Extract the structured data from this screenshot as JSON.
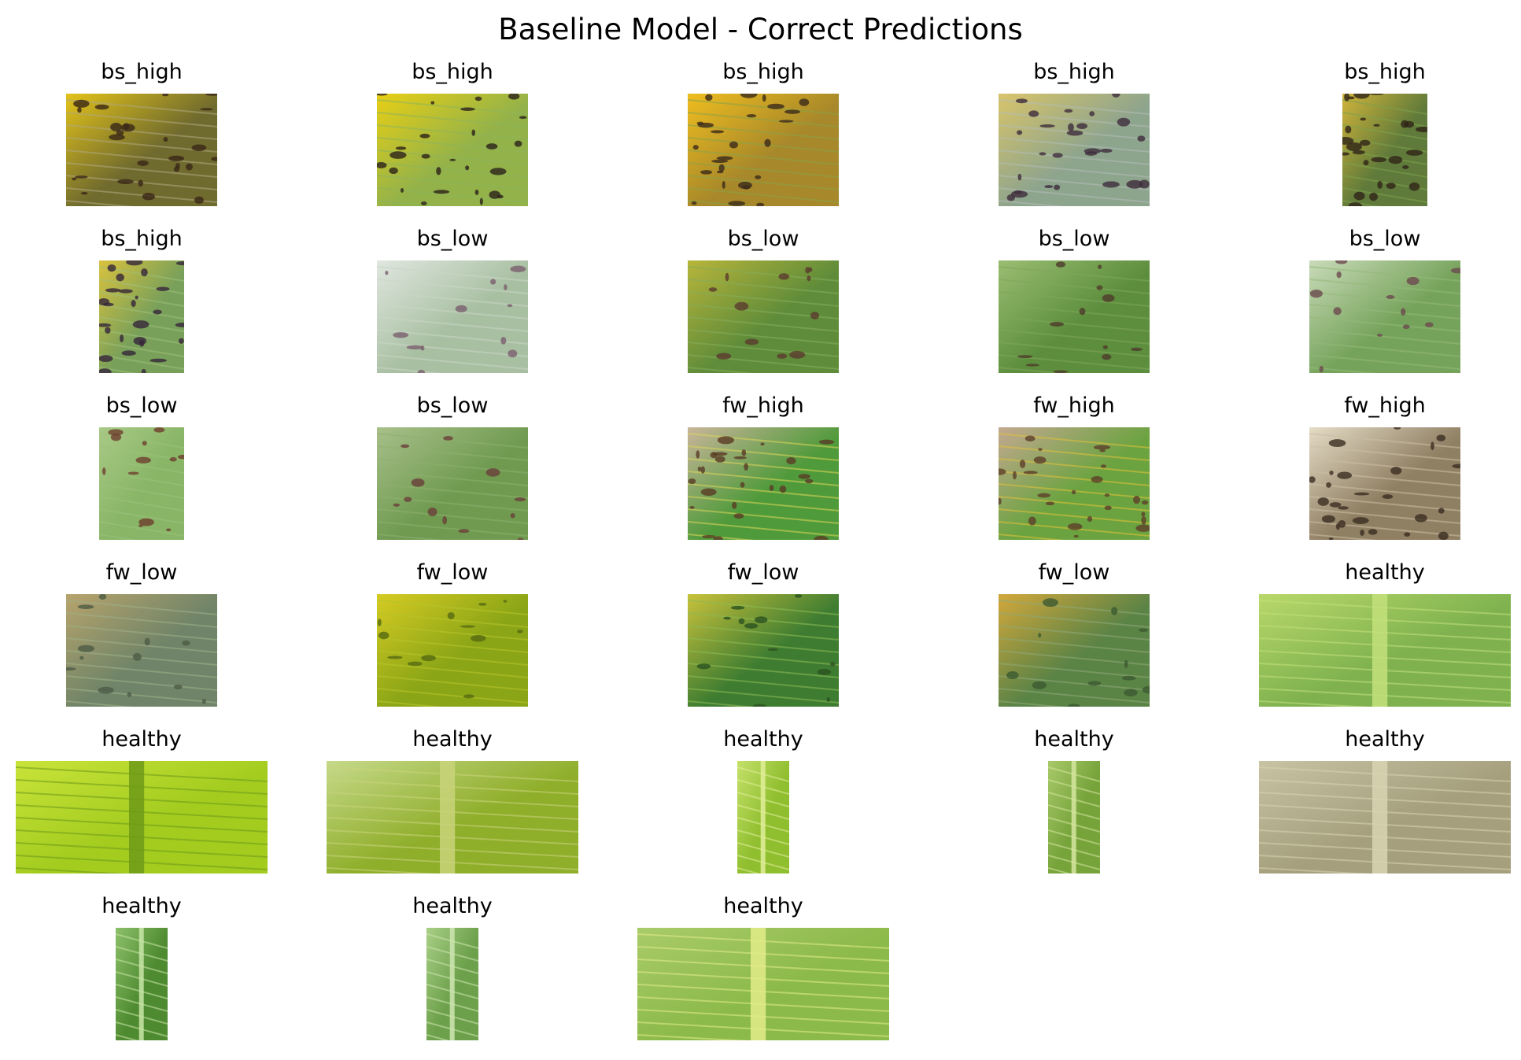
{
  "title": "Baseline Model - Correct Predictions",
  "columns": 5,
  "panels": [
    {
      "label": "bs_high",
      "aspect": "landscape",
      "palette": {
        "base": "#6f6a2e",
        "accent": "#e3c31a",
        "spot": "#3a2716",
        "vein": "#b0a880"
      }
    },
    {
      "label": "bs_high",
      "aspect": "landscape",
      "palette": {
        "base": "#93b24a",
        "accent": "#e8cf14",
        "spot": "#2d2219",
        "vein": "#8fb55c"
      }
    },
    {
      "label": "bs_high",
      "aspect": "landscape",
      "palette": {
        "base": "#a7882a",
        "accent": "#efbd1f",
        "spot": "#3b2a1a",
        "vein": "#8aa34a"
      }
    },
    {
      "label": "bs_high",
      "aspect": "landscape",
      "palette": {
        "base": "#8da48d",
        "accent": "#d8c46a",
        "spot": "#3e2d3c",
        "vein": "#b3bdb6"
      }
    },
    {
      "label": "bs_high",
      "aspect": "narrow",
      "palette": {
        "base": "#5f7a3a",
        "accent": "#d1b43b",
        "spot": "#2f2418",
        "vein": "#7ea24d"
      }
    },
    {
      "label": "bs_high",
      "aspect": "narrow",
      "palette": {
        "base": "#79a05a",
        "accent": "#d9c23e",
        "spot": "#36263a",
        "vein": "#9fc07a"
      }
    },
    {
      "label": "bs_low",
      "aspect": "landscape",
      "palette": {
        "base": "#a8bfa2",
        "accent": "#e0e7df",
        "spot": "#7a5f6e",
        "vein": "#cbd6c7"
      }
    },
    {
      "label": "bs_low",
      "aspect": "landscape",
      "palette": {
        "base": "#5f8c3a",
        "accent": "#b7b53a",
        "spot": "#5b3b2e",
        "vein": "#86ad5c"
      }
    },
    {
      "label": "bs_low",
      "aspect": "landscape",
      "palette": {
        "base": "#5c8e3d",
        "accent": "#9bbd72",
        "spot": "#4f3b2c",
        "vein": "#7fa85a"
      }
    },
    {
      "label": "bs_low",
      "aspect": "landscape",
      "palette": {
        "base": "#76a35b",
        "accent": "#c9dbb9",
        "spot": "#6d4a4f",
        "vein": "#94b97a"
      }
    },
    {
      "label": "bs_low",
      "aspect": "narrow",
      "palette": {
        "base": "#88b566",
        "accent": "#a9c986",
        "spot": "#6e3e2e",
        "vein": "#9cc27c"
      }
    },
    {
      "label": "bs_low",
      "aspect": "landscape",
      "palette": {
        "base": "#6f9a50",
        "accent": "#a8c08a",
        "spot": "#6a3f3a",
        "vein": "#8fb06f"
      }
    },
    {
      "label": "fw_high",
      "aspect": "landscape",
      "palette": {
        "base": "#4f9a3a",
        "accent": "#c9b59a",
        "spot": "#5a3b26",
        "vein": "#dcd65a"
      }
    },
    {
      "label": "fw_high",
      "aspect": "landscape",
      "palette": {
        "base": "#6aa33f",
        "accent": "#c3a890",
        "spot": "#5e3f2b",
        "vein": "#e2c23a"
      }
    },
    {
      "label": "fw_high",
      "aspect": "landscape",
      "palette": {
        "base": "#8f7f63",
        "accent": "#e5dcc6",
        "spot": "#3b2e22",
        "vein": "#cbbfa3"
      }
    },
    {
      "label": "fw_low",
      "aspect": "landscape",
      "palette": {
        "base": "#6f8468",
        "accent": "#b8a46c",
        "spot": "#4e5b46",
        "vein": "#9fb08a"
      }
    },
    {
      "label": "fw_low",
      "aspect": "landscape",
      "palette": {
        "base": "#8aa516",
        "accent": "#d6cb23",
        "spot": "#566a12",
        "vein": "#b6c52b"
      }
    },
    {
      "label": "fw_low",
      "aspect": "landscape",
      "palette": {
        "base": "#3d7c31",
        "accent": "#c9c23b",
        "spot": "#2c5220",
        "vein": "#8dbb54"
      }
    },
    {
      "label": "fw_low",
      "aspect": "landscape",
      "palette": {
        "base": "#5a8346",
        "accent": "#d3a83b",
        "spot": "#3c5a31",
        "vein": "#8fa978"
      }
    },
    {
      "label": "healthy",
      "aspect": "wide",
      "palette": {
        "base": "#7fb24f",
        "accent": "#b9d86a",
        "spot": "#6ca142",
        "vein": "#c3e07b"
      }
    },
    {
      "label": "healthy",
      "aspect": "wide",
      "palette": {
        "base": "#a3cc1f",
        "accent": "#c9e33a",
        "spot": "#8ab21a",
        "vein": "#6d9a18"
      }
    },
    {
      "label": "healthy",
      "aspect": "wide",
      "palette": {
        "base": "#8fae2a",
        "accent": "#c6d98a",
        "spot": "#6e8c1f",
        "vein": "#c9d47a"
      }
    },
    {
      "label": "healthy",
      "aspect": "tall",
      "palette": {
        "base": "#8fbe2e",
        "accent": "#c4e06a",
        "spot": "#6c9e22",
        "vein": "#e2ef9a"
      }
    },
    {
      "label": "healthy",
      "aspect": "tall",
      "palette": {
        "base": "#76a33a",
        "accent": "#a8c96a",
        "spot": "#58842a",
        "vein": "#d6e6a0"
      }
    },
    {
      "label": "healthy",
      "aspect": "wide",
      "palette": {
        "base": "#a59f7d",
        "accent": "#c7c3a3",
        "spot": "#8a8464",
        "vein": "#d8d3b0"
      }
    },
    {
      "label": "healthy",
      "aspect": "tall",
      "palette": {
        "base": "#4e8a30",
        "accent": "#8cc06a",
        "spot": "#356a22",
        "vein": "#c9e6a8"
      }
    },
    {
      "label": "healthy",
      "aspect": "tall",
      "palette": {
        "base": "#6ca04a",
        "accent": "#a8cf86",
        "spot": "#3e6e2a",
        "vein": "#cfe6b2"
      }
    },
    {
      "label": "healthy",
      "aspect": "wide",
      "palette": {
        "base": "#8cba4a",
        "accent": "#a9cb6a",
        "spot": "#6f9c35",
        "vein": "#e3ec8a"
      }
    }
  ]
}
